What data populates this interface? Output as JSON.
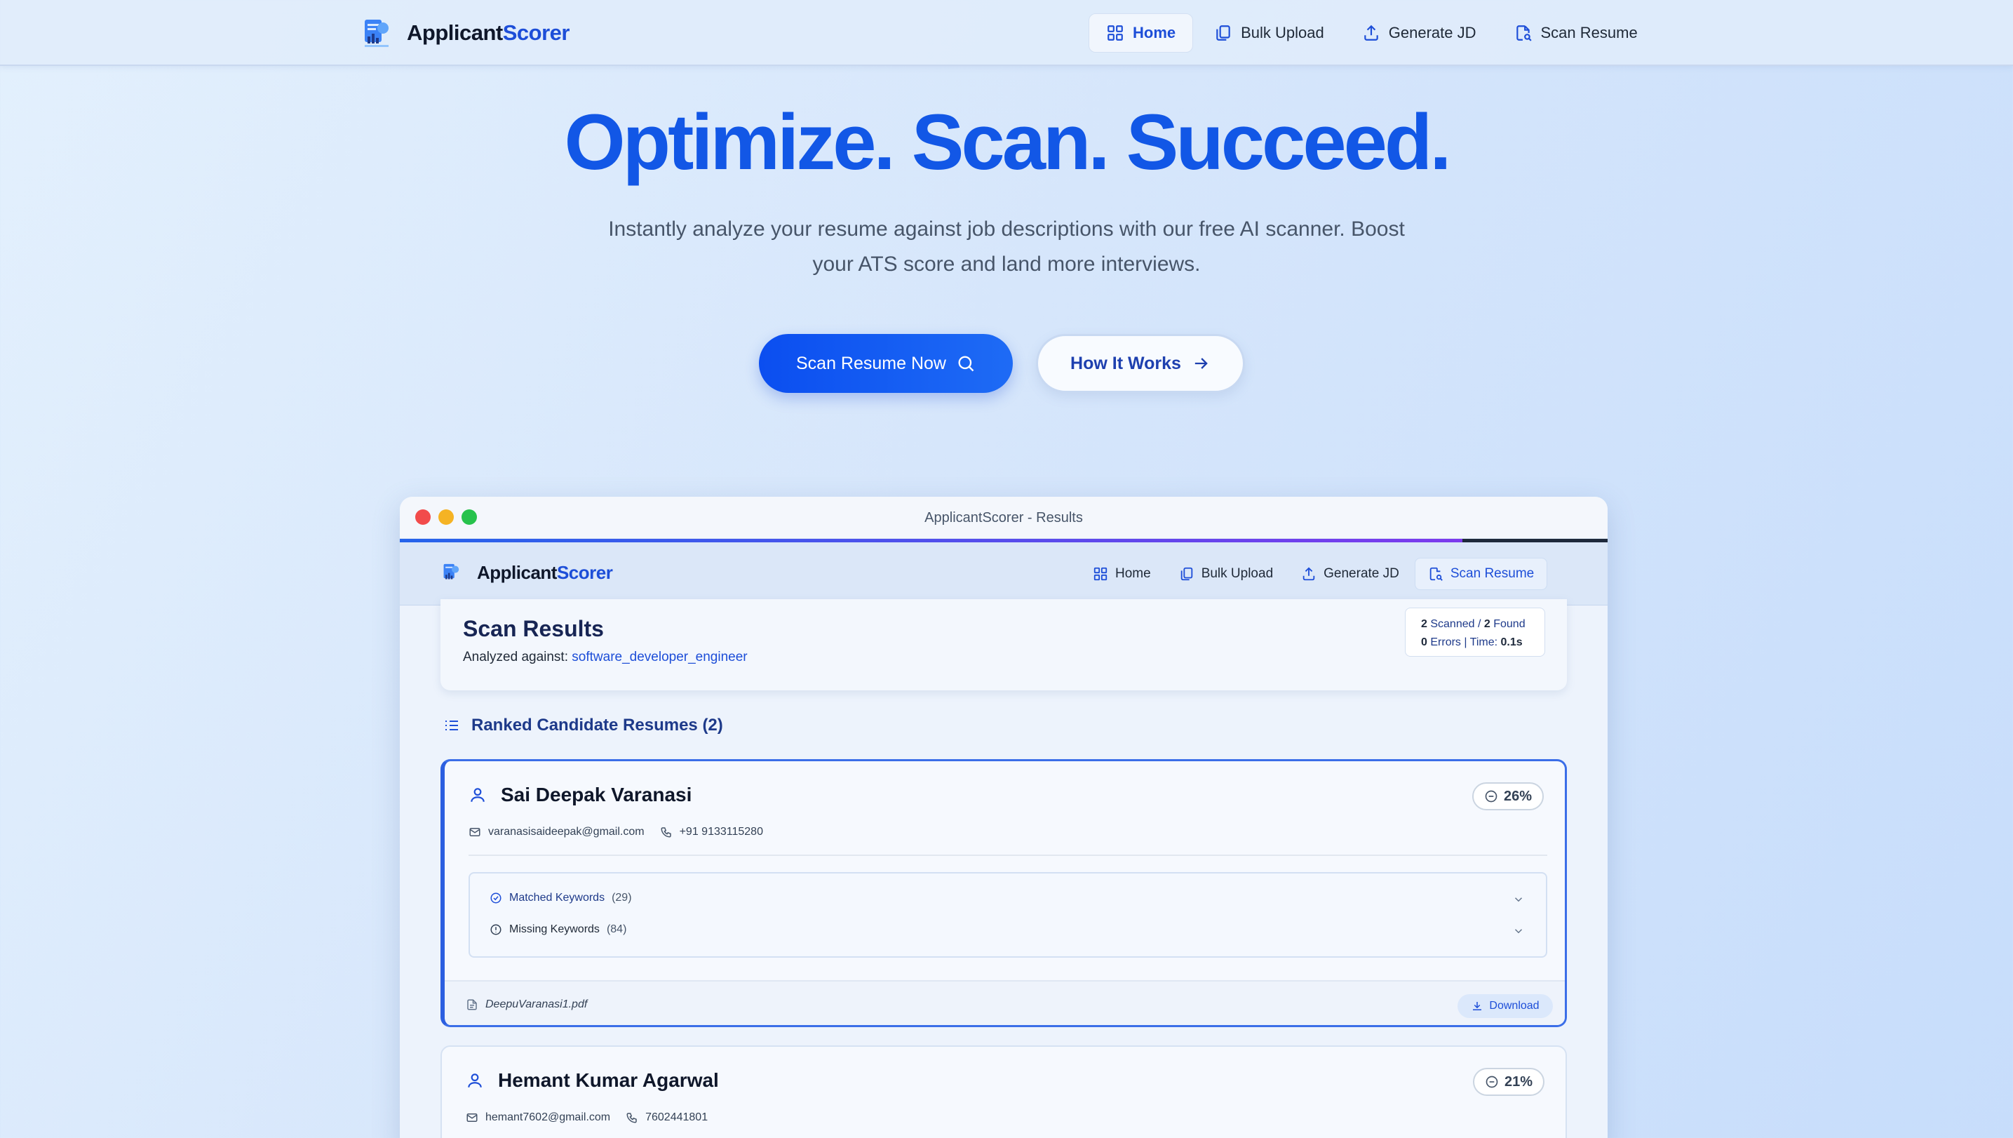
{
  "brand": {
    "part1": "Applicant",
    "part2": "Scorer"
  },
  "nav": [
    {
      "label": "Home",
      "icon": "grid-icon",
      "active": true
    },
    {
      "label": "Bulk Upload",
      "icon": "files-icon",
      "active": false
    },
    {
      "label": "Generate JD",
      "icon": "upload-icon",
      "active": false
    },
    {
      "label": "Scan Resume",
      "icon": "document-scan-icon",
      "active": false
    }
  ],
  "hero": {
    "title": "Optimize. Scan. Succeed.",
    "subtitle": "Instantly analyze your resume against job descriptions with our free AI scanner. Boost your ATS score and land more interviews.",
    "primary_button": "Scan Resume Now",
    "secondary_button": "How It Works"
  },
  "preview": {
    "window_title": "ApplicantScorer - Results",
    "progress": 0.88,
    "nav": [
      {
        "label": "Home",
        "active": false
      },
      {
        "label": "Bulk Upload",
        "active": false
      },
      {
        "label": "Generate JD",
        "active": false
      },
      {
        "label": "Scan Resume",
        "active": true
      }
    ],
    "results": {
      "title": "Scan Results",
      "analyzed_label": "Analyzed against:",
      "jd_name": "software_developer_engineer",
      "scanned": "2",
      "scanned_label": "Scanned /",
      "found": "2",
      "found_label": "Found",
      "errors": "0",
      "errors_label": "Errors | Time:",
      "time": "0.1s"
    },
    "ranked_title": "Ranked Candidate Resumes (2)",
    "candidates": [
      {
        "name": "Sai Deepak Varanasi",
        "score": "26%",
        "email": "varanasisaideepak@gmail.com",
        "phone": "+91 9133115280",
        "matched_label": "Matched Keywords",
        "matched_count": "(29)",
        "missing_label": "Missing Keywords",
        "missing_count": "(84)",
        "file": "DeepuVaranasi1.pdf",
        "download_label": "Download"
      },
      {
        "name": "Hemant Kumar Agarwal",
        "score": "21%",
        "email": "hemant7602@gmail.com",
        "phone": "7602441801"
      }
    ]
  },
  "colors": {
    "accent": "#1257e6",
    "brand_dark": "#0f172a",
    "background": "#d6e6fb"
  }
}
